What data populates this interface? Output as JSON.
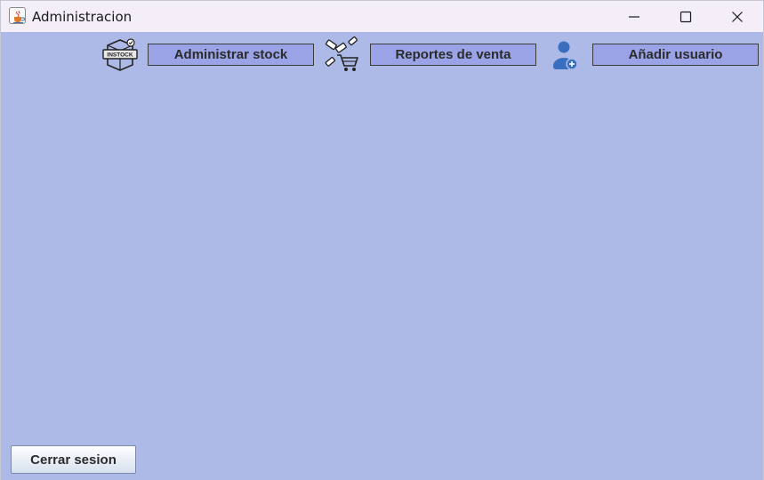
{
  "window": {
    "title": "Administracion",
    "app_icon": "java-cup-icon",
    "controls": {
      "minimize_icon": "minimize-icon",
      "maximize_icon": "maximize-icon",
      "close_icon": "close-icon"
    }
  },
  "toolbar": {
    "stock": {
      "icon": "in-stock-icon",
      "label": "Administrar stock"
    },
    "sales": {
      "icon": "shopping-cart-icon",
      "label": "Reportes de venta"
    },
    "user": {
      "icon": "add-user-icon",
      "label": "Añadir usuario"
    }
  },
  "footer": {
    "logout_label": "Cerrar sesion"
  },
  "colors": {
    "background": "#adb9e6",
    "button": "#9aa3e6",
    "titlebar": "#f3eef7",
    "user_icon": "#3a6fc0"
  }
}
